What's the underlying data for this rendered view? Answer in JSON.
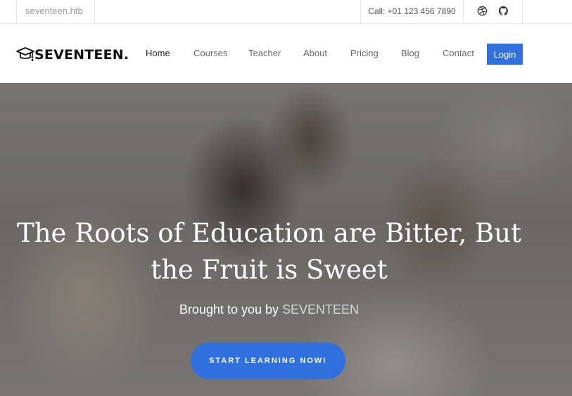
{
  "topbar": {
    "domain": "seventeen.htb",
    "call": "Call: +01 123 456 7890",
    "social_icons": [
      "dribbble-icon",
      "github-icon"
    ]
  },
  "logo": {
    "icon": "graduation-cap-icon",
    "text": "SEVENTEEN."
  },
  "nav": {
    "items": [
      {
        "label": "Home",
        "active": true
      },
      {
        "label": "Courses",
        "active": false
      },
      {
        "label": "Teacher",
        "active": false
      },
      {
        "label": "About",
        "active": false
      },
      {
        "label": "Pricing",
        "active": false
      },
      {
        "label": "Blog",
        "active": false
      },
      {
        "label": "Contact",
        "active": false
      }
    ],
    "login": "Login"
  },
  "hero": {
    "title_line1": "The Roots of Education are Bitter, But",
    "title_line2": "the Fruit is Sweet",
    "sub_prefix": "Brought to you by",
    "sub_brand": "SEVENTEEN",
    "cta": "START LEARNING NOW!"
  },
  "colors": {
    "accent": "#2f6fde",
    "text_dark": "#222222",
    "text_muted": "#666666",
    "border": "#e6e6e6"
  }
}
